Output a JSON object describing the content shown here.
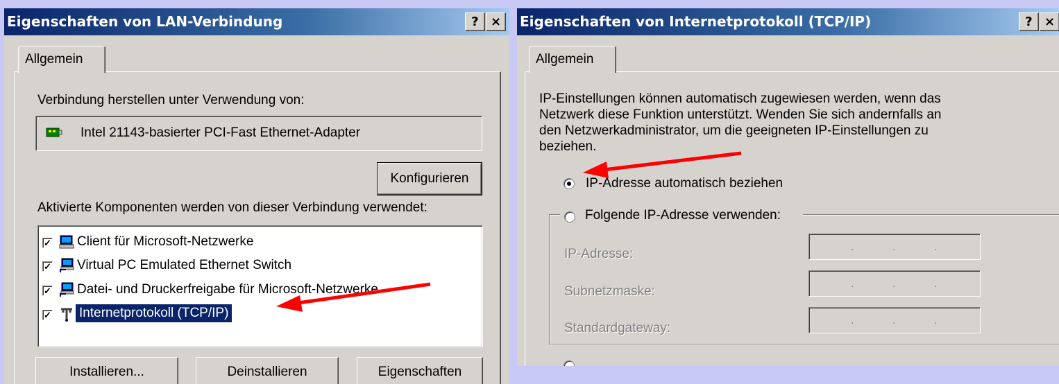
{
  "left_dialog": {
    "title": "Eigenschaften von LAN-Verbindung",
    "help_label": "?",
    "close_label": "×",
    "tab_label": "Allgemein",
    "connect_using_label": "Verbindung herstellen unter Verwendung von:",
    "adapter_name": "Intel 21143-basierter PCI-Fast Ethernet-Adapter",
    "configure_button": "Konfigurieren",
    "components_label": "Aktivierte Komponenten werden von dieser Verbindung verwendet:",
    "components": [
      {
        "label": "Client für Microsoft-Netzwerke",
        "checked": true,
        "icon": "network-computer-icon"
      },
      {
        "label": "Virtual PC Emulated Ethernet Switch",
        "checked": true,
        "icon": "network-service-icon"
      },
      {
        "label": "Datei- und Druckerfreigabe für Microsoft-Netzwerke",
        "checked": true,
        "icon": "network-service-icon"
      },
      {
        "label": "Internetprotokoll (TCP/IP)",
        "checked": true,
        "icon": "protocol-icon",
        "selected": true
      }
    ],
    "install_button": "Installieren...",
    "uninstall_button": "Deinstallieren",
    "properties_button": "Eigenschaften",
    "check_mark": "✓"
  },
  "right_dialog": {
    "title": "Eigenschaften von Internetprotokoll (TCP/IP)",
    "help_label": "?",
    "close_label": "×",
    "tab_label": "Allgemein",
    "description_lines": [
      "IP-Einstellungen können automatisch zugewiesen werden, wenn das",
      "Netzwerk diese Funktion unterstützt. Wenden Sie sich andernfalls an",
      "den Netzwerkadministrator, um die geeigneten IP-Einstellungen zu",
      "beziehen."
    ],
    "radio_auto_label": "IP-Adresse automatisch beziehen",
    "radio_auto_selected": true,
    "radio_manual_label": "Folgende IP-Adresse verwenden:",
    "radio_manual_selected": false,
    "fields": [
      {
        "label": "IP-Adresse:",
        "value": ". . ."
      },
      {
        "label": "Subnetzmaske:",
        "value": ". . ."
      },
      {
        "label": "Standardgateway:",
        "value": ". . ."
      }
    ]
  },
  "colors": {
    "background": "#c8c8f4",
    "titlebar": "#0a246a",
    "annotation_arrow": "#ff0000",
    "selection": "#0a246a"
  }
}
